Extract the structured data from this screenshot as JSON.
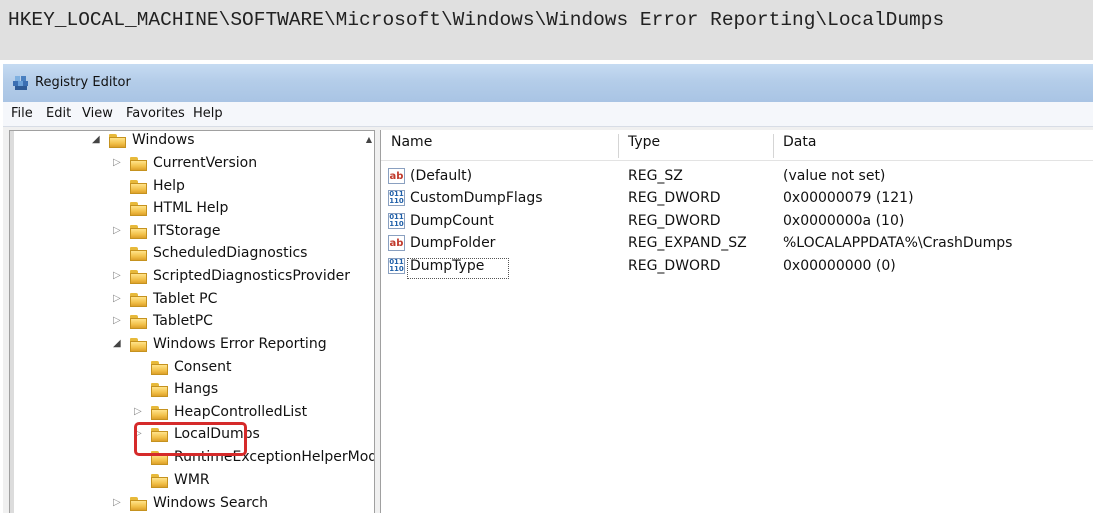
{
  "registry_path": "HKEY_LOCAL_MACHINE\\SOFTWARE\\Microsoft\\Windows\\Windows Error Reporting\\LocalDumps",
  "window": {
    "title": "Registry Editor"
  },
  "menu": [
    "File",
    "Edit",
    "View",
    "Favorites",
    "Help"
  ],
  "tree": [
    {
      "label": "Windows",
      "expander": "◢",
      "selected": false
    },
    {
      "label": "CurrentVersion",
      "expander": "▷"
    },
    {
      "label": "Help",
      "expander": ""
    },
    {
      "label": "HTML Help",
      "expander": ""
    },
    {
      "label": "ITStorage",
      "expander": "▷"
    },
    {
      "label": "ScheduledDiagnostics",
      "expander": ""
    },
    {
      "label": "ScriptedDiagnosticsProvider",
      "expander": "▷"
    },
    {
      "label": "Tablet PC",
      "expander": "▷"
    },
    {
      "label": "TabletPC",
      "expander": "▷"
    },
    {
      "label": "Windows Error Reporting",
      "expander": "◢"
    },
    {
      "label": "Consent",
      "expander": ""
    },
    {
      "label": "Hangs",
      "expander": ""
    },
    {
      "label": "HeapControlledList",
      "expander": "▷"
    },
    {
      "label": "LocalDumps",
      "expander": "▷"
    },
    {
      "label": "RuntimeExceptionHelperModules",
      "expander": ""
    },
    {
      "label": "WMR",
      "expander": ""
    },
    {
      "label": "Windows Search",
      "expander": "▷"
    }
  ],
  "columns": [
    "Name",
    "Type",
    "Data"
  ],
  "values": [
    {
      "icon": "string-value-icon",
      "name": "(Default)",
      "type": "REG_SZ",
      "data": "(value not set)"
    },
    {
      "icon": "binary-value-icon",
      "name": "CustomDumpFlags",
      "type": "REG_DWORD",
      "data": "0x00000079 (121)"
    },
    {
      "icon": "binary-value-icon",
      "name": "DumpCount",
      "type": "REG_DWORD",
      "data": "0x0000000a (10)"
    },
    {
      "icon": "string-value-icon",
      "name": "DumpFolder",
      "type": "REG_EXPAND_SZ",
      "data": "%LOCALAPPDATA%\\CrashDumps"
    },
    {
      "icon": "binary-value-icon",
      "name": "DumpType",
      "type": "REG_DWORD",
      "data": "0x00000000 (0)"
    }
  ],
  "colors": {
    "highlight": "#d52a2a",
    "folder": "#f2c14a",
    "titlebar": "#b4cde9"
  }
}
